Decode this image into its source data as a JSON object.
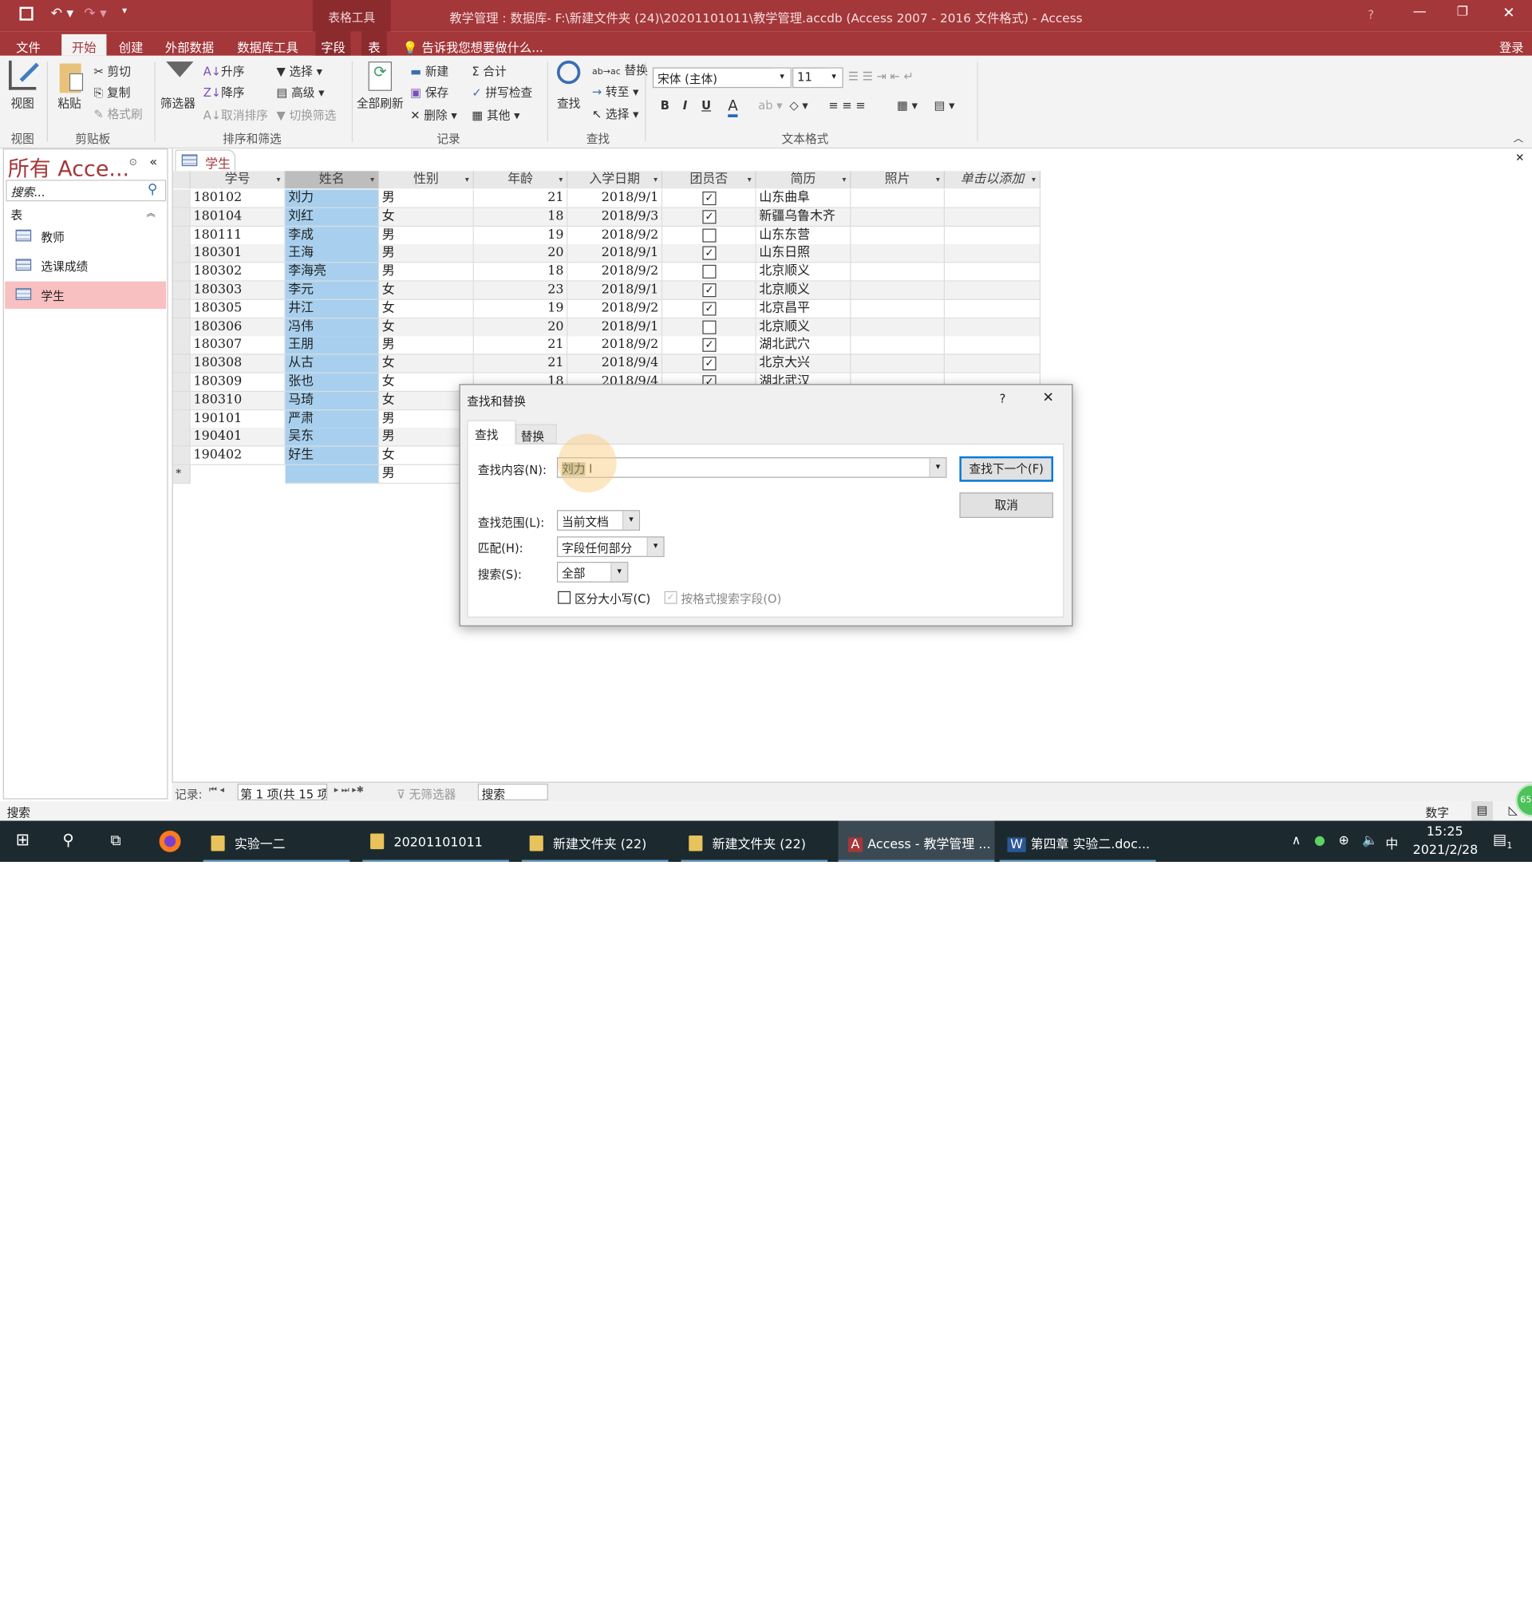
{
  "window": {
    "title": "教学管理 : 数据库- F:\\新建文件夹 (24)\\20201101011\\教学管理.accdb (Access 2007 - 2016 文件格式) - Access",
    "context_tab": "表格工具",
    "login": "登录",
    "help": "?"
  },
  "tabs": [
    "文件",
    "开始",
    "创建",
    "外部数据",
    "数据库工具",
    "字段",
    "表"
  ],
  "tell_me": "告诉我您想要做什么...",
  "ribbon": {
    "view": "视图",
    "paste": "粘贴",
    "cut": "剪切",
    "copy": "复制",
    "format_painter": "格式刷",
    "filter": "筛选器",
    "ascending": "升序",
    "descending": "降序",
    "remove_sort": "取消排序",
    "selection": "选择",
    "advanced": "高级",
    "toggle_filter": "切换筛选",
    "refresh_all": "全部刷新",
    "new": "新建",
    "save": "保存",
    "delete": "删除",
    "totals": "合计",
    "spelling": "拼写检查",
    "more": "其他",
    "find": "查找",
    "replace": "替换",
    "goto": "转至",
    "select": "选择",
    "font": "宋体 (主体)",
    "font_size": "11",
    "groups": [
      "视图",
      "剪贴板",
      "排序和筛选",
      "记录",
      "查找",
      "文本格式"
    ]
  },
  "nav": {
    "title": "所有 Acce...",
    "search_placeholder": "搜索...",
    "section": "表",
    "items": [
      "教师",
      "选课成绩",
      "学生"
    ],
    "selected": "学生"
  },
  "document": {
    "tab": "学生"
  },
  "table": {
    "columns": [
      "学号",
      "姓名",
      "性别",
      "年龄",
      "入学日期",
      "团员否",
      "简历",
      "照片",
      "单击以添加"
    ],
    "rows": [
      [
        "180102",
        "刘力",
        "男",
        21,
        "2018/9/1",
        true,
        "山东曲阜"
      ],
      [
        "180104",
        "刘红",
        "女",
        18,
        "2018/9/3",
        true,
        "新疆乌鲁木齐"
      ],
      [
        "180111",
        "李成",
        "男",
        19,
        "2018/9/2",
        false,
        "山东东营"
      ],
      [
        "180301",
        "王海",
        "男",
        20,
        "2018/9/1",
        true,
        "山东日照"
      ],
      [
        "180302",
        "李海亮",
        "男",
        18,
        "2018/9/2",
        false,
        "北京顺义"
      ],
      [
        "180303",
        "李元",
        "女",
        23,
        "2018/9/1",
        true,
        "北京顺义"
      ],
      [
        "180305",
        "井江",
        "女",
        19,
        "2018/9/2",
        true,
        "北京昌平"
      ],
      [
        "180306",
        "冯伟",
        "女",
        20,
        "2018/9/1",
        false,
        "北京顺义"
      ],
      [
        "180307",
        "王朋",
        "男",
        21,
        "2018/9/2",
        true,
        "湖北武穴"
      ],
      [
        "180308",
        "从古",
        "女",
        21,
        "2018/9/4",
        true,
        "北京大兴"
      ],
      [
        "180309",
        "张也",
        "女",
        18,
        "2018/9/4",
        true,
        "湖北武汉"
      ],
      [
        "180310",
        "马琦",
        "女"
      ],
      [
        "190101",
        "严肃",
        "男"
      ],
      [
        "190401",
        "吴东",
        "男"
      ],
      [
        "190402",
        "好生",
        "女"
      ]
    ],
    "new_row": {
      "marker": "*",
      "sex_default": "男"
    }
  },
  "record_nav": {
    "label": "记录:",
    "position": "第 1 项(共 15 项",
    "no_filter": "无筛选器",
    "search": "搜索"
  },
  "status": {
    "left": "搜索",
    "right": "数字"
  },
  "dialog": {
    "title": "查找和替换",
    "help": "?",
    "tabs": [
      "查找",
      "替换"
    ],
    "find_label": "查找内容(N):",
    "find_value": "刘力",
    "lookin_label": "查找范围(L):",
    "lookin_value": "当前文档",
    "match_label": "匹配(H):",
    "match_value": "字段任何部分",
    "search_label": "搜索(S):",
    "search_value": "全部",
    "match_case": "区分大小写(C)",
    "match_case_checked": false,
    "search_formatted": "按格式搜索字段(O)",
    "search_formatted_checked": true,
    "find_next": "查找下一个(F)",
    "cancel": "取消"
  },
  "taskbar": {
    "items": [
      "实验一二",
      "20201101011",
      "新建文件夹 (22)",
      "新建文件夹 (22)",
      "Access - 教学管理 ...",
      "第四章 实验二.doc..."
    ],
    "ime": "中",
    "time": "15:25",
    "date": "2021/2/28",
    "notifications": "1",
    "badge": "65"
  },
  "colors": {
    "accent": "#a4373a",
    "selection": "#a8d0ee",
    "nav_selected": "#f8c0c0",
    "taskbar": "#1c2a30"
  }
}
